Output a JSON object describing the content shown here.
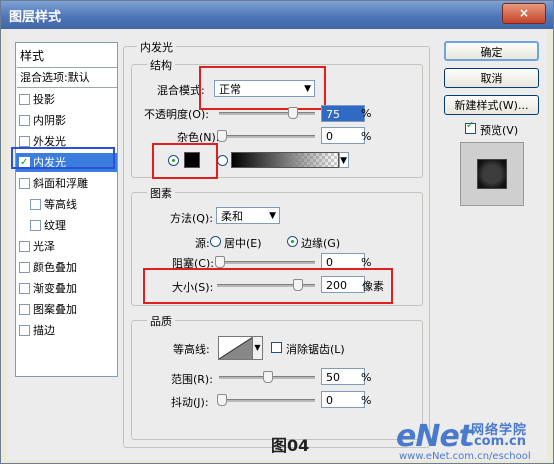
{
  "window": {
    "title": "图层样式",
    "close": "×"
  },
  "styles_panel": {
    "header": "样式",
    "blend_item": "混合选项:默认",
    "items": [
      {
        "label": "投影",
        "checked": false
      },
      {
        "label": "内阴影",
        "checked": false
      },
      {
        "label": "外发光",
        "checked": false
      },
      {
        "label": "内发光",
        "checked": true,
        "selected": true
      },
      {
        "label": "斜面和浮雕",
        "checked": false
      },
      {
        "label": "等高线",
        "checked": false,
        "sub": true
      },
      {
        "label": "纹理",
        "checked": false,
        "sub": true
      },
      {
        "label": "光泽",
        "checked": false
      },
      {
        "label": "颜色叠加",
        "checked": false
      },
      {
        "label": "渐变叠加",
        "checked": false
      },
      {
        "label": "图案叠加",
        "checked": false
      },
      {
        "label": "描边",
        "checked": false
      }
    ]
  },
  "inner_glow": {
    "title": "内发光",
    "structure": {
      "title": "结构",
      "blend_mode_label": "混合模式:",
      "blend_mode_value": "正常",
      "opacity_label": "不透明度(O):",
      "opacity_value": "75",
      "noise_label": "杂色(N):",
      "noise_value": "0",
      "unit": "%",
      "color": "#000000"
    },
    "elements": {
      "title": "图素",
      "technique_label": "方法(Q):",
      "technique_value": "柔和",
      "source_label": "源:",
      "source_center": "居中(E)",
      "source_edge": "边缘(G)",
      "choke_label": "阻塞(C):",
      "choke_value": "0",
      "size_label": "大小(S):",
      "size_value": "200",
      "size_unit": "像素",
      "unit": "%"
    },
    "quality": {
      "title": "品质",
      "contour_label": "等高线:",
      "antialias_label": "消除锯齿(L)",
      "range_label": "范围(R):",
      "range_value": "50",
      "jitter_label": "抖动(J):",
      "jitter_value": "0",
      "unit": "%"
    }
  },
  "buttons": {
    "ok": "确定",
    "cancel": "取消",
    "new_style": "新建样式(W)...",
    "preview_label": "预览(V)"
  },
  "caption": "图04",
  "watermark": {
    "logo": "eNet",
    "cn": "网络学院",
    "domain": ".com.cn",
    "url": "www.eNet.com.cn/eschool"
  },
  "colors": {
    "accent_red": "#e0201e",
    "selection": "#3a7dde",
    "title_bar": "#4f76b8"
  }
}
